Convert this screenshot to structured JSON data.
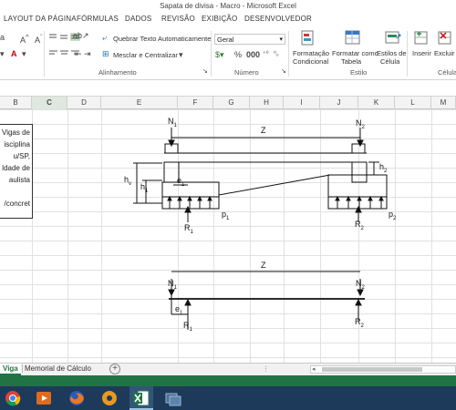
{
  "window": {
    "title": "Sapata de divisa - Macro - Microsoft Excel"
  },
  "tabs": [
    "LAYOUT DA PÁGINA",
    "FÓRMULAS",
    "DADOS",
    "REVISÃO",
    "EXIBIÇÃO",
    "DESENVOLVEDOR"
  ],
  "ribbon": {
    "wrap_text": "Quebrar Texto Automaticamente",
    "merge_center": "Mesclar e Centralizar",
    "number_format": "Geral",
    "cond_format": [
      "Formatação",
      "Condicional"
    ],
    "format_table": [
      "Formatar como",
      "Tabela"
    ],
    "cell_styles": [
      "Estilos de",
      "Célula"
    ],
    "insert": "Inserir",
    "delete": "Excluir",
    "groups": {
      "alignment": "Alinhamento",
      "number": "Número",
      "style": "Estilo",
      "cells": "Células"
    }
  },
  "columns": [
    "B",
    "C",
    "D",
    "E",
    "F",
    "G",
    "H",
    "I",
    "J",
    "K",
    "L",
    "M"
  ],
  "textbox_lines": [
    "Vigas de",
    "isciplina",
    "u/SP,",
    "ldade de",
    "aulista",
    "",
    "/concret"
  ],
  "diagram": {
    "top": {
      "N1": "N",
      "N2": "N",
      "Z": "Z",
      "hv": "h",
      "h1": "h",
      "h2": "h",
      "e1": "e",
      "p1": "p",
      "p2": "p",
      "R1": "R",
      "R2": "R"
    },
    "bottom": {
      "Z": "Z",
      "N1": "N",
      "N2": "N",
      "e1": "e",
      "R1": "R",
      "R2": "R"
    }
  },
  "sheets": [
    "Viga",
    "Memorial de Cálculo"
  ],
  "colors": {
    "excel_green": "#217346",
    "taskbar": "#1e3a5a"
  }
}
